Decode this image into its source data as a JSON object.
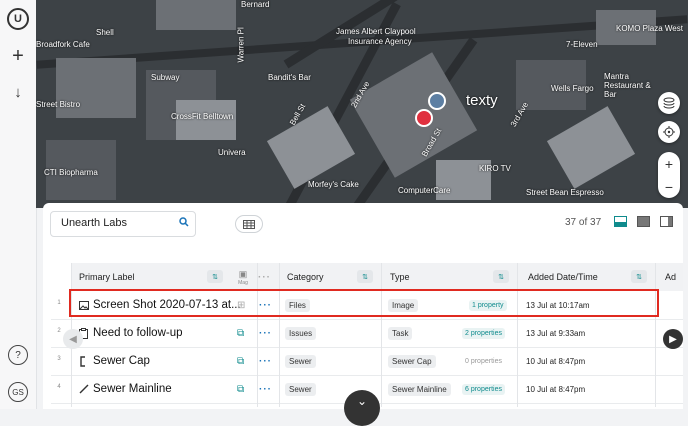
{
  "sidebar": {
    "logo": "U",
    "add": "+",
    "download": "↓",
    "help": "?",
    "user_initials": "GS"
  },
  "map": {
    "labels": [
      "Shell",
      "Bernard",
      "James Albert Claypool",
      "Insurance Agency",
      "KOMO Plaza West",
      "7-Eleven",
      "Broadfork Cafe",
      "Subway",
      "Bandit's Bar",
      "Street Bistro",
      "CrossFit Belltown",
      "Univera",
      "CTI Biopharma",
      "Morfey's Cake",
      "ComputerCare",
      "KIRO TV",
      "Wells Fargo",
      "Mantra Restaurant & Bar",
      "Street Bean Espresso",
      "Warren Pl",
      "2nd Ave",
      "3rd Ave",
      "Broad St",
      "Bell St"
    ],
    "brand_text": "texty"
  },
  "panel": {
    "search_value": "Unearth Labs",
    "count": "37 of 37",
    "columns": {
      "primary_label": "Primary Label",
      "img": "Mag",
      "category": "Category",
      "type": "Type",
      "added": "Added Date/Time",
      "ad": "Ad"
    },
    "rows": [
      {
        "num": "1",
        "label": "Screen Shot 2020-07-13 at...",
        "category": "Files",
        "type": "Image",
        "props": "1 property",
        "added": "13 Jul at 10:17am"
      },
      {
        "num": "2",
        "label": "Need to follow-up",
        "category": "Issues",
        "type": "Task",
        "props": "2 properties",
        "added": "13 Jul at 9:33am"
      },
      {
        "num": "3",
        "label": "Sewer Cap",
        "category": "Sewer",
        "type": "Sewer Cap",
        "props": "0 properties",
        "added": "10 Jul at 8:47pm"
      },
      {
        "num": "4",
        "label": "Sewer Mainline",
        "category": "Sewer",
        "type": "Sewer Mainline",
        "props": "6 properties",
        "added": "10 Jul at 8:47pm"
      }
    ]
  },
  "colors": {
    "accent": "#0f8b8d",
    "selection": "#e02a20",
    "link": "#1a73b8"
  }
}
